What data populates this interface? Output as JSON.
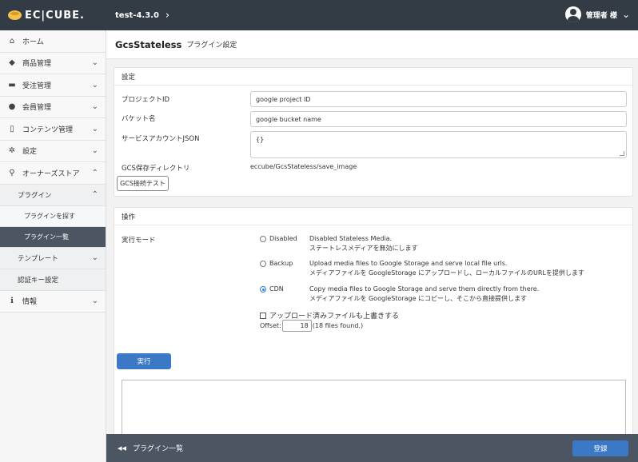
{
  "header": {
    "logo_text": "EC|CUBE.",
    "shop_name": "test-4.3.0",
    "user_name": "管理者 様"
  },
  "sidebar": {
    "items": [
      {
        "label": "ホーム",
        "icon": "home-icon"
      },
      {
        "label": "商品管理",
        "icon": "cube-icon"
      },
      {
        "label": "受注管理",
        "icon": "cart-icon"
      },
      {
        "label": "会員管理",
        "icon": "users-icon"
      },
      {
        "label": "コンテンツ管理",
        "icon": "file-icon"
      },
      {
        "label": "設定",
        "icon": "gear-icon"
      },
      {
        "label": "オーナーズストア",
        "icon": "plug-icon"
      }
    ],
    "plugin_label": "プラグイン",
    "plugin_search": "プラグインを探す",
    "plugin_list": "プラグイン一覧",
    "template_label": "テンプレート",
    "auth_key": "認証キー設定",
    "info_label": "情報"
  },
  "page": {
    "title": "GcsStateless",
    "subtitle": "プラグイン設定"
  },
  "settings": {
    "heading": "設定",
    "project_id_label": "プロジェクトID",
    "project_id_value": "google project ID",
    "bucket_label": "バケット名",
    "bucket_value": "google bucket name",
    "service_account_label": "サービスアカウントJSON",
    "service_account_value": "{}",
    "gcs_dir_label": "GCS保存ディレクトリ",
    "gcs_dir_value": "eccube/GcsStateless/save_image",
    "test_button": "GCS接続テスト"
  },
  "operation": {
    "heading": "操作",
    "mode_label": "実行モード",
    "modes": [
      {
        "label": "Disabled",
        "desc_en": "Disabled Stateless Media.",
        "desc_ja": "ステートレスメディアを無効にします",
        "checked": false
      },
      {
        "label": "Backup",
        "desc_en": "Upload media files to Google Storage and serve local file urls.",
        "desc_ja": "メディアファイルを GoogleStorage にアップロードし、ローカルファイルのURLを提供します",
        "checked": false
      },
      {
        "label": "CDN",
        "desc_en": "Copy media files to Google Storage and serve them directly from there.",
        "desc_ja": "メディアファイルを GoogleStorage にコピーし、そこから直接提供します",
        "checked": true
      }
    ],
    "overwrite_label": "アップロード済みファイルも上書きする",
    "offset_label": "Offset:",
    "offset_value": "18",
    "files_found": "(18 files found.)",
    "execute_button": "実行"
  },
  "footer": {
    "back_label": "プラグイン一覧",
    "register_button": "登録"
  },
  "colors": {
    "header_bg": "#333c45",
    "accent": "#3b79c7",
    "active_nav": "#4b5662"
  }
}
